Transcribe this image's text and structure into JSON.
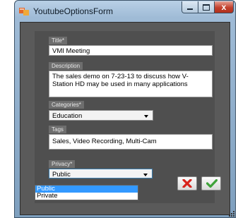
{
  "window": {
    "title": "YoutubeOptionsForm",
    "close_glyph": "x"
  },
  "form": {
    "title": {
      "label": "Title*",
      "value": "VMI Meeting"
    },
    "description": {
      "label": "Description",
      "value": "The sales demo on 7-23-13 to discuss how V-Station HD may be used in many applications"
    },
    "categories": {
      "label": "Categories*",
      "value": "Education"
    },
    "tags": {
      "label": "Tags",
      "value": "Sales, Video Recording, Multi-Cam"
    },
    "privacy": {
      "label": "Privacy*",
      "value": "Public",
      "options": [
        "Public",
        "Private"
      ],
      "highlighted": "Public"
    }
  },
  "buttons": {
    "cancel": {
      "icon": "red-x-icon"
    },
    "confirm": {
      "icon": "green-checkmark-icon"
    }
  },
  "colors": {
    "cancel_icon": "#d8231c",
    "confirm_icon": "#3fa33a",
    "selection": "#3399ff"
  }
}
